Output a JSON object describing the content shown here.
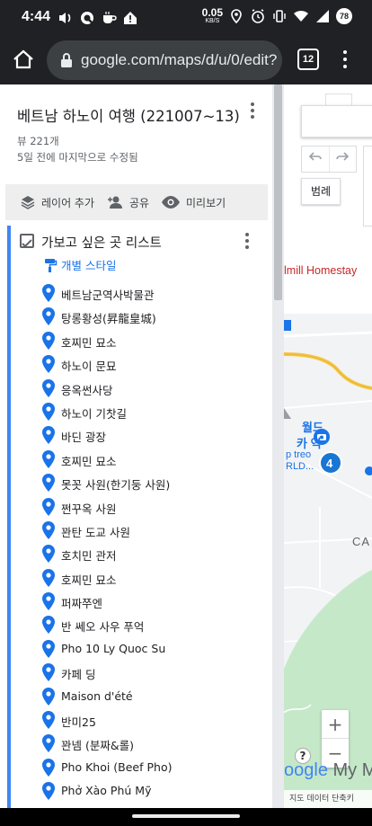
{
  "status_bar": {
    "time": "4:44",
    "net_speed": "0.05",
    "net_unit": "KB/S",
    "battery": "78"
  },
  "browser": {
    "url": "google.com/maps/d/u/0/edit?",
    "tab_count": "12"
  },
  "map_info": {
    "title": "베트남 하노이 여행 (221007~13)",
    "views": "뷰 221개",
    "modified": "5일 전에 마지막으로 수정됨"
  },
  "actions": {
    "add_layer": "레이어 추가",
    "share": "공유",
    "preview": "미리보기"
  },
  "layer": {
    "title": "가보고 싶은 곳 리스트",
    "style_label": "개별 스타일",
    "items": [
      "베트남군역사박물관",
      "탕롱황성(昇龍皇城)",
      "호찌민 묘소",
      "하노이 문묘",
      "응옥썬사당",
      "하노이 기찻길",
      "바딘 광장",
      "호찌민 묘소",
      "못꼿 사원(한기둥 사원)",
      "쩐꾸옥 사원",
      "꽌탄 도교 사원",
      "호치민 관저",
      "호찌민 묘소",
      "퍼짜쭈엔",
      "반 쎄오 사우 푸억",
      "Pho 10 Ly Quoc Su",
      "카페 딩",
      "Maison d'été",
      "반미25",
      "꽌넴 (분짜&롤)",
      "Pho Khoi (Beef Pho)",
      "Phở Xào Phú Mỹ"
    ]
  },
  "map_view": {
    "legend_button": "범례",
    "label_homestay": "lmill Homestay",
    "label_world1": "월드",
    "label_station": "카 역",
    "label_treo": "p treo",
    "label_rld": "RLD...",
    "label_ca": "CA",
    "cluster_count": "4",
    "zoom_in": "+",
    "zoom_out": "−",
    "help": "?",
    "logo_google": "oogle",
    "logo_my": "My Ma",
    "footer": "지도 데이터  단축키"
  },
  "colors": {
    "accent_blue": "#4285f4",
    "pin_blue": "#1a73e8",
    "cluster_blue": "#1976d2",
    "road_yellow": "#f6c543",
    "park_green": "#c5e8c9"
  }
}
